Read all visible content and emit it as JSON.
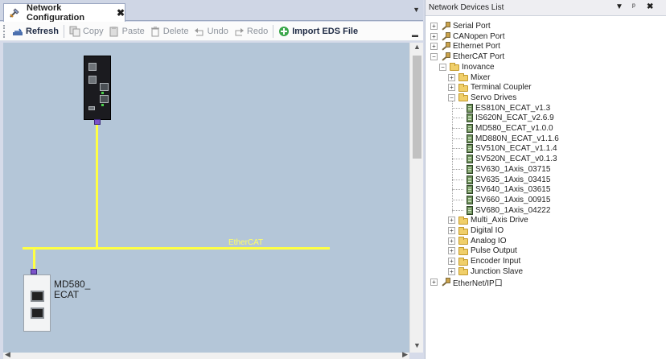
{
  "document": {
    "tab_title": "Network Configuration",
    "tab_close": "✖",
    "dropdown": "▼"
  },
  "toolbar": {
    "refresh": "Refresh",
    "copy": "Copy",
    "paste": "Paste",
    "delete": "Delete",
    "undo": "Undo",
    "redo": "Redo",
    "import_eds": "Import EDS File"
  },
  "canvas": {
    "bus_label": "EtherCAT",
    "slave_label": "MD580_ ECAT"
  },
  "devices_pane": {
    "title": "Network Devices List",
    "buttons": {
      "menu": "▼",
      "pin": "ᵖ",
      "close": "✖"
    },
    "tree": [
      {
        "label": "Serial Port",
        "icon": "plug-icon",
        "expander": "+"
      },
      {
        "label": "CANopen Port",
        "icon": "plug-icon",
        "expander": "+"
      },
      {
        "label": "Ethernet Port",
        "icon": "plug-icon",
        "expander": "+"
      },
      {
        "label": "EtherCAT Port",
        "icon": "plug-icon",
        "expander": "−"
      },
      {
        "label": "Inovance",
        "icon": "folder-icon",
        "expander": "−"
      },
      {
        "label": "Mixer",
        "icon": "folder-icon",
        "expander": "+"
      },
      {
        "label": "Terminal Coupler",
        "icon": "folder-icon",
        "expander": "+"
      },
      {
        "label": "Servo Drives",
        "icon": "folder-icon",
        "expander": "−"
      },
      {
        "label": "ES810N_ECAT_v1.3",
        "icon": "device-icon"
      },
      {
        "label": "IS620N_ECAT_v2.6.9",
        "icon": "device-icon"
      },
      {
        "label": "MD580_ECAT_v1.0.0",
        "icon": "device-icon"
      },
      {
        "label": "MD880N_ECAT_v1.1.6",
        "icon": "device-icon"
      },
      {
        "label": "SV510N_ECAT_v1.1.4",
        "icon": "device-icon"
      },
      {
        "label": "SV520N_ECAT_v0.1.3",
        "icon": "device-icon"
      },
      {
        "label": "SV630_1Axis_03715",
        "icon": "device-icon"
      },
      {
        "label": "SV635_1Axis_03415",
        "icon": "device-icon"
      },
      {
        "label": "SV640_1Axis_03615",
        "icon": "device-icon"
      },
      {
        "label": "SV660_1Axis_00915",
        "icon": "device-icon"
      },
      {
        "label": "SV680_1Axis_04222",
        "icon": "device-icon"
      },
      {
        "label": "Multi_Axis Drive",
        "icon": "folder-icon",
        "expander": "+"
      },
      {
        "label": "Digital IO",
        "icon": "folder-icon",
        "expander": "+"
      },
      {
        "label": " Analog IO",
        "icon": "folder-icon",
        "expander": "+"
      },
      {
        "label": "Pulse Output",
        "icon": "folder-icon",
        "expander": "+"
      },
      {
        "label": "Encoder Input",
        "icon": "folder-icon",
        "expander": "+"
      },
      {
        "label": "Junction Slave",
        "icon": "folder-icon",
        "expander": "+"
      },
      {
        "label": "EtherNet/IP口",
        "icon": "plug-icon",
        "expander": "+"
      }
    ]
  },
  "colors": {
    "canvas_bg": "#b4c6d8",
    "bus_line": "#ffff44",
    "connector": "#7b52c9"
  }
}
